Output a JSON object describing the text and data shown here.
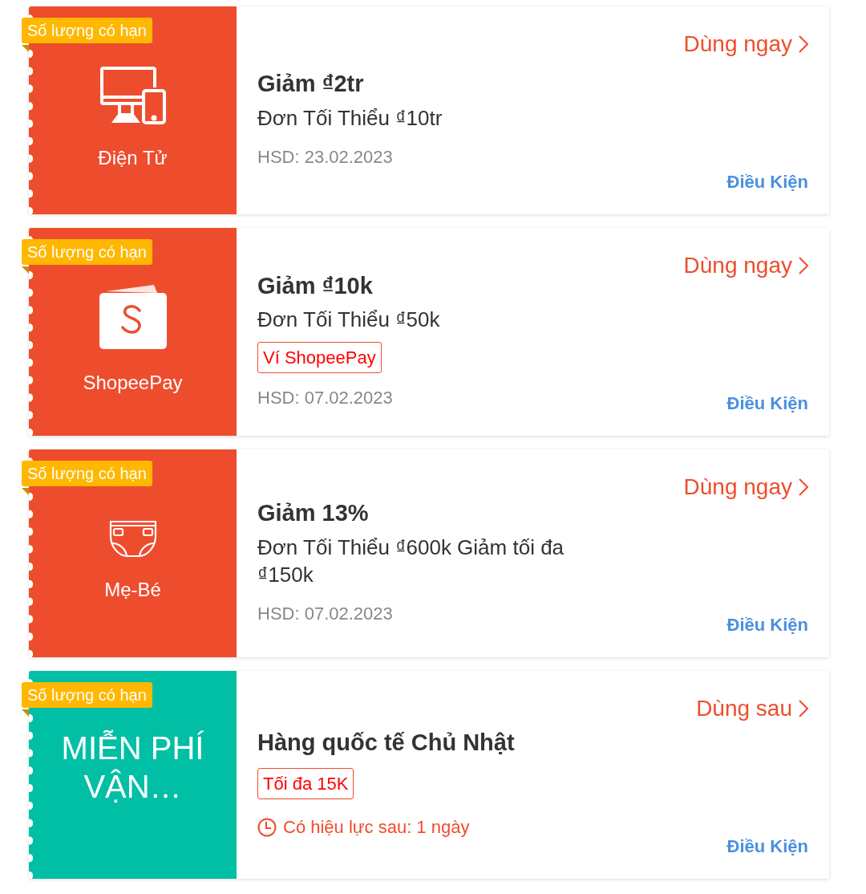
{
  "vouchers": [
    {
      "kind": "electronics",
      "color": "#ee4d2d",
      "badge": "Số lượng có hạn",
      "stub_label": "Điện Tử",
      "title": "Giảm ₫2tr",
      "min_order": "Đơn Tối Thiểu ₫10tr",
      "expiry": "HSD: 23.02.2023",
      "action": "Dùng ngay",
      "conditions": "Điều Kiện"
    },
    {
      "kind": "wallet",
      "color": "#ee4d2d",
      "badge": "Số lượng có hạn",
      "stub_label": "ShopeePay",
      "title": "Giảm ₫10k",
      "min_order": "Đơn Tối Thiểu ₫50k",
      "tag": "Ví ShopeePay",
      "expiry": "HSD: 07.02.2023",
      "action": "Dùng ngay",
      "conditions": "Điều Kiện"
    },
    {
      "kind": "diaper",
      "color": "#ee4d2d",
      "badge": "Số lượng có hạn",
      "stub_label": "Mẹ-Bé",
      "title": "Giảm 13%",
      "min_order": "Đơn Tối Thiểu ₫600k Giảm tối đa ₫150k",
      "expiry": "HSD: 07.02.2023",
      "action": "Dùng ngay",
      "conditions": "Điều Kiện"
    },
    {
      "kind": "text",
      "color": "#00bfa5",
      "badge": "Số lượng có hạn",
      "stub_label": "MIỄN PHÍ VẬN…",
      "title": "Hàng quốc tế Chủ Nhật",
      "tag": "Tối đa 15K",
      "validity": "Có hiệu lực sau: 1 ngày",
      "action": "Dùng sau",
      "conditions": "Điều Kiện"
    }
  ]
}
